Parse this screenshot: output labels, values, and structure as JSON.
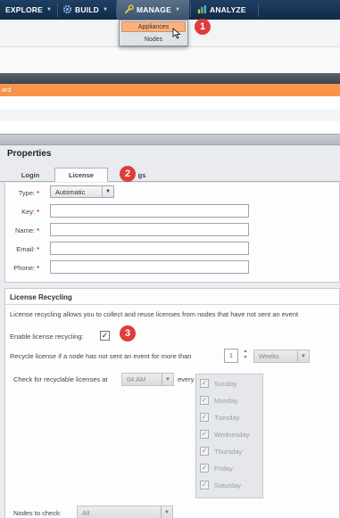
{
  "nav": {
    "explore": "EXPLORE",
    "build": "BUILD",
    "manage": "MANAGE",
    "analyze": "ANALYZE",
    "manage_menu": [
      "Appliances",
      "Nodes"
    ]
  },
  "callouts": [
    "1",
    "2",
    "3"
  ],
  "background_row": "ard",
  "properties": {
    "title": "Properties",
    "tabs": [
      "Login",
      "License",
      "gs"
    ],
    "active_tab": "License",
    "type_label": "Type:",
    "type_value": "Automatic",
    "key_label": "Key:",
    "name_label": "Name:",
    "email_label": "Email:",
    "phone_label": "Phone:",
    "required_mark": "*",
    "key_value": "",
    "name_value": "",
    "email_value": "",
    "phone_value": ""
  },
  "recycling": {
    "title": "License Recycling",
    "description": "License recycling allows you to collect and reuse licenses from nodes that have not sent an event",
    "enable_label": "Enable license recycling:",
    "enabled": true,
    "recycle_label": "Recycle license if a node has not sent an event for more than",
    "recycle_value": "1",
    "recycle_unit": "Weeks",
    "check_label": "Check for recyclable licenses at",
    "check_time": "04 AM",
    "every_label": "every",
    "days": [
      "Sunday",
      "Monday",
      "Tuesday",
      "Wednesday",
      "Thursday",
      "Friday",
      "Saturday"
    ],
    "check_mark": "✓",
    "nodes_label": "Nodes to check:",
    "nodes_value": "All"
  },
  "colors": {
    "nav_bg": "#112a47",
    "menu_highlight": "#f7b27f",
    "callout": "#e23b3b",
    "selected_row": "#f7944a"
  }
}
